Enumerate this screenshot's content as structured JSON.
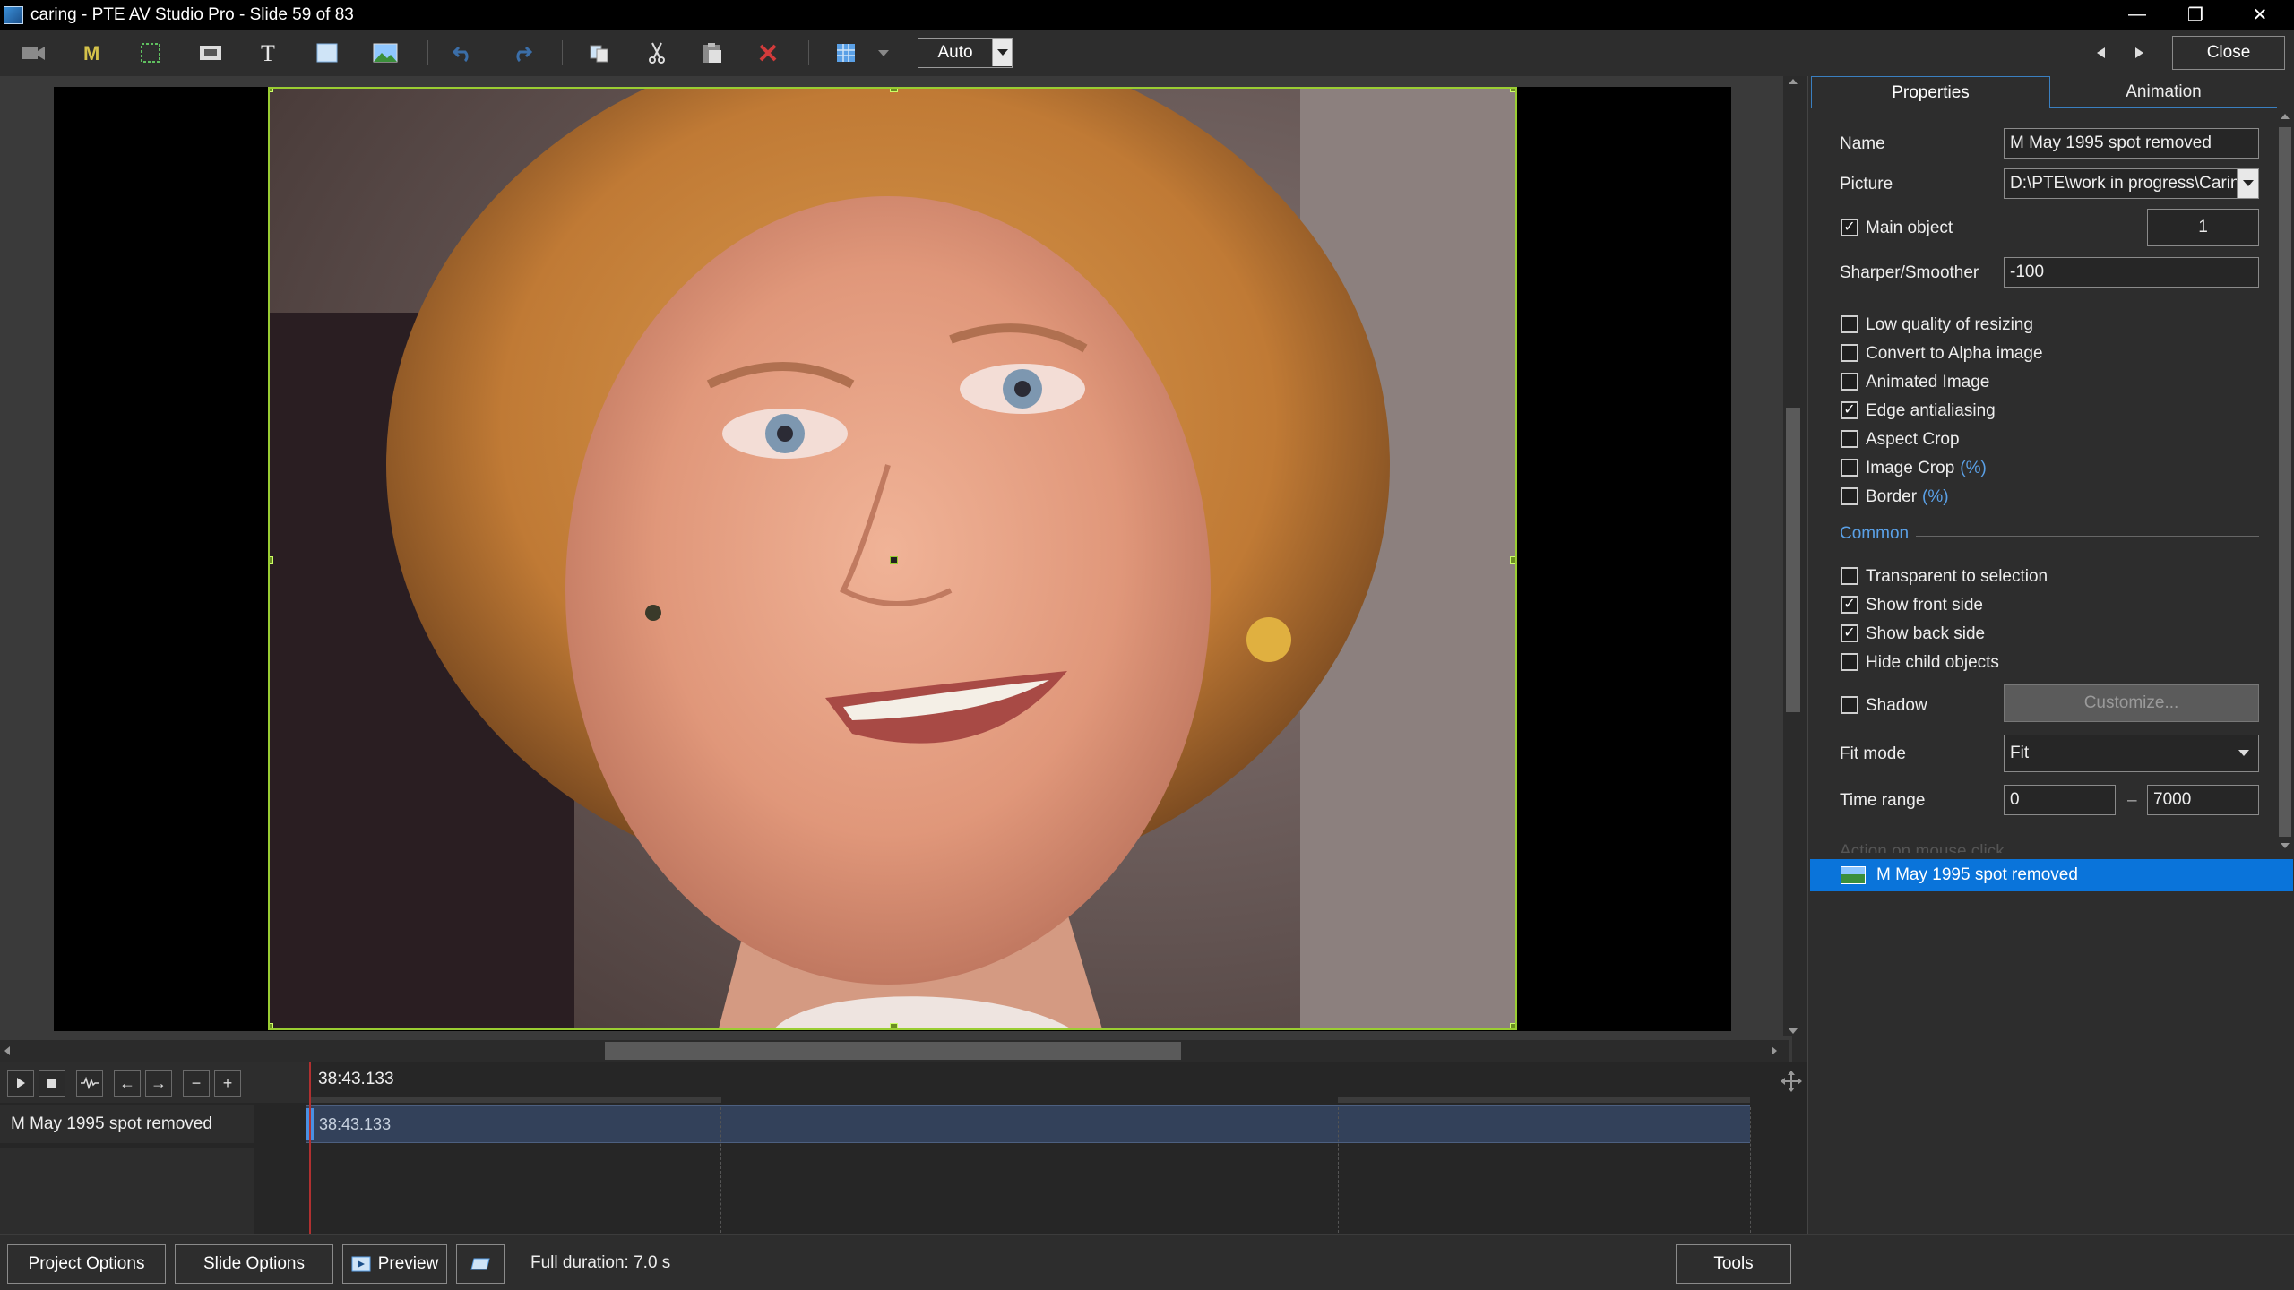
{
  "window": {
    "title": "caring - PTE AV Studio Pro - Slide 59 of 83"
  },
  "toolbar": {
    "zoom_value": "Auto",
    "close_label": "Close"
  },
  "tabs": {
    "properties": "Properties",
    "animation": "Animation"
  },
  "properties": {
    "name_label": "Name",
    "name_value": "M May 1995 spot removed",
    "picture_label": "Picture",
    "picture_value": "D:\\PTE\\work in progress\\Caring",
    "main_object_label": "Main object",
    "main_object_value": "1",
    "sharper_label": "Sharper/Smoother",
    "sharper_value": "-100",
    "checks": [
      {
        "label": "Low quality of resizing",
        "checked": false,
        "suffix": ""
      },
      {
        "label": "Convert to Alpha image",
        "checked": false,
        "suffix": ""
      },
      {
        "label": "Animated Image",
        "checked": false,
        "suffix": ""
      },
      {
        "label": "Edge antialiasing",
        "checked": true,
        "suffix": ""
      },
      {
        "label": "Aspect Crop",
        "checked": false,
        "suffix": ""
      },
      {
        "label": "Image Crop",
        "checked": false,
        "suffix": "(%)"
      },
      {
        "label": "Border",
        "checked": false,
        "suffix": "(%)"
      }
    ],
    "common_label": "Common",
    "common_checks": [
      {
        "label": "Transparent to selection",
        "checked": false
      },
      {
        "label": "Show front side",
        "checked": true
      },
      {
        "label": "Show back side",
        "checked": true
      },
      {
        "label": "Hide child objects",
        "checked": false
      }
    ],
    "shadow_label": "Shadow",
    "shadow_checked": false,
    "customize_label": "Customize...",
    "fit_mode_label": "Fit mode",
    "fit_mode_value": "Fit",
    "time_range_label": "Time range",
    "time_from": "0",
    "time_dash": "–",
    "time_to": "7000",
    "action_label": "Action on mouse click"
  },
  "object_list": {
    "items": [
      "M May 1995 spot removed"
    ]
  },
  "timeline": {
    "ruler_time": "38:43.133",
    "track_name": "M May 1995 spot removed",
    "track_time": "38:43.133"
  },
  "bottom": {
    "project_options": "Project Options",
    "slide_options": "Slide Options",
    "preview": "Preview",
    "full_duration": "Full duration: 7.0 s",
    "tools": "Tools"
  },
  "colors": {
    "accent": "#0a74da",
    "selection": "#9acd32",
    "link": "#5aa0e6"
  },
  "icons": [
    "camera-icon",
    "mask-icon",
    "frame-icon",
    "video-icon",
    "text-icon",
    "rectangle-icon",
    "image-icon",
    "undo-icon",
    "redo-icon",
    "copy-icon",
    "cut-icon",
    "paste-icon",
    "delete-icon",
    "grid-icon"
  ]
}
